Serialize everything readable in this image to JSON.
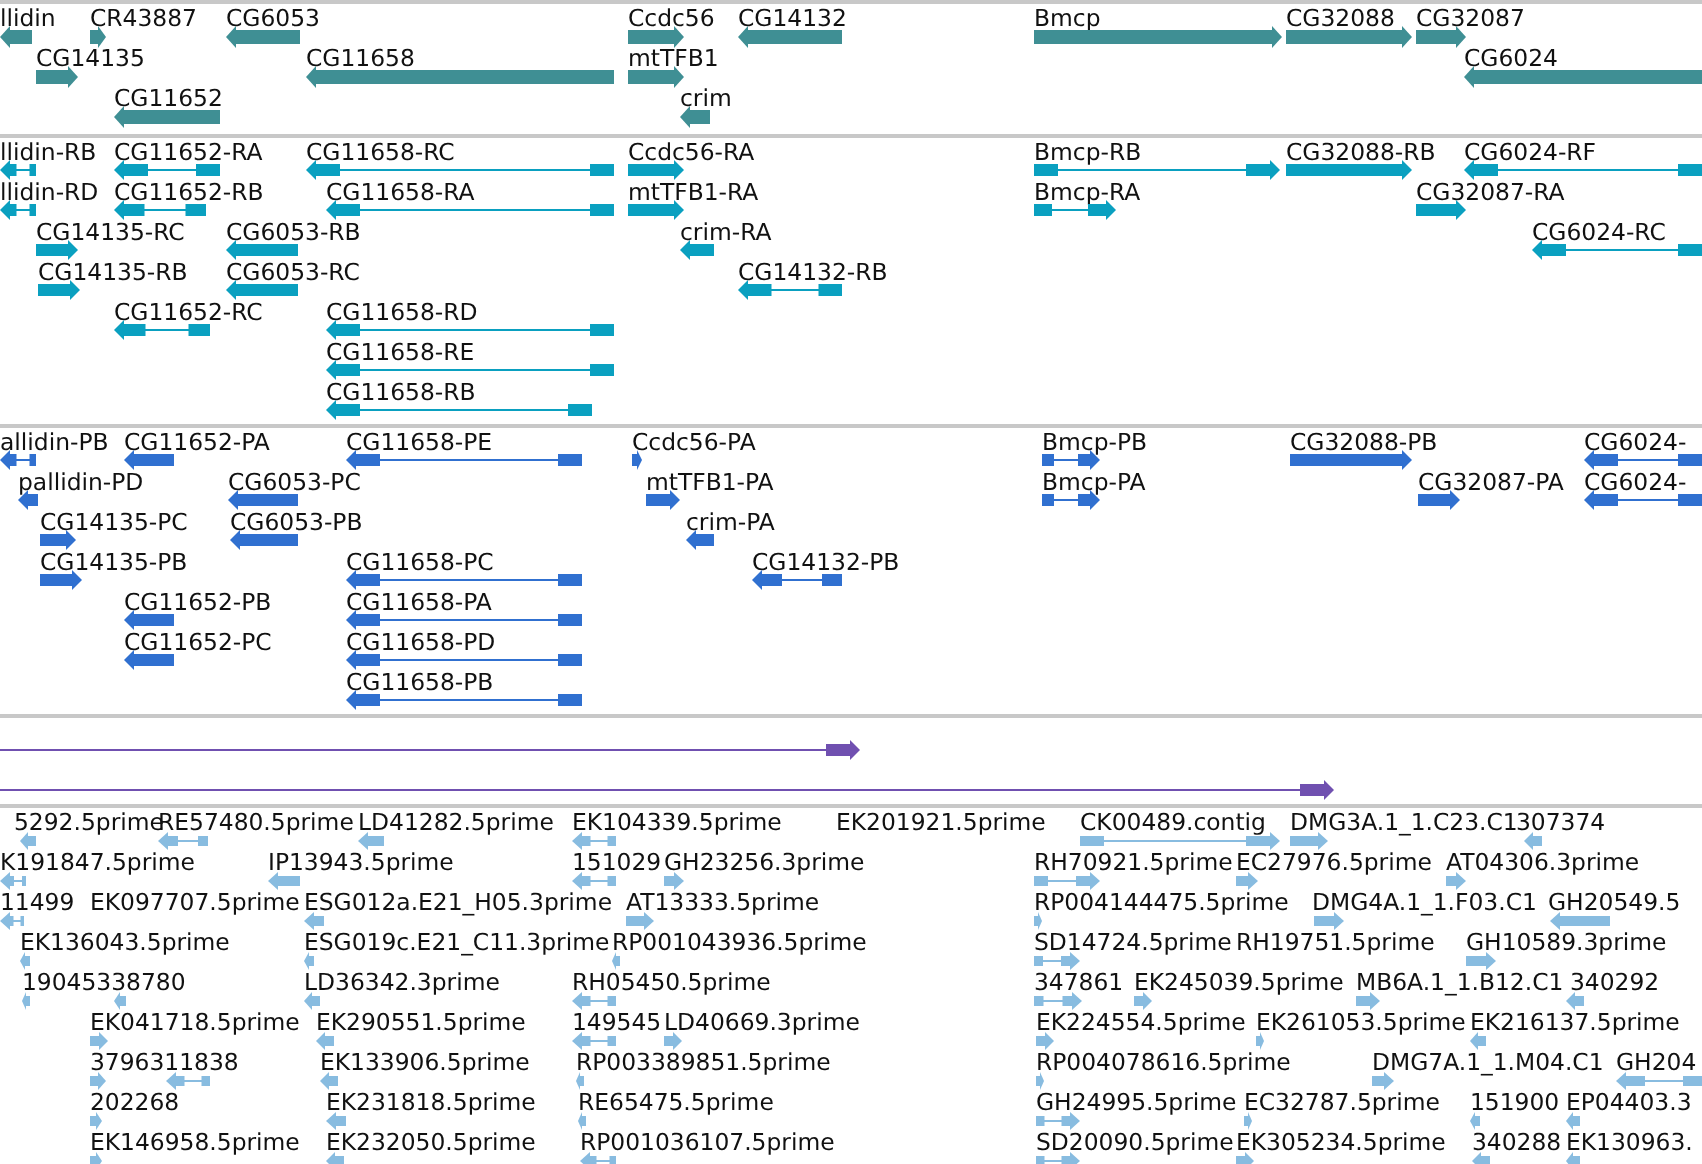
{
  "tracks": [
    {
      "color": "#3f8f94",
      "features": [
        {
          "label": "llidin",
          "reverse": true
        },
        {
          "label": "CR43887",
          "reverse": false
        },
        {
          "label": "CG6053",
          "reverse": true
        },
        {
          "label": "Ccdc56",
          "reverse": false
        },
        {
          "label": "CG14132",
          "reverse": true
        },
        {
          "label": "Bmcp",
          "reverse": false
        },
        {
          "label": "CG32088",
          "reverse": false
        },
        {
          "label": "CG32087",
          "reverse": false
        },
        {
          "label": "CG14135",
          "reverse": false
        },
        {
          "label": "CG11658",
          "reverse": true
        },
        {
          "label": "mtTFB1",
          "reverse": false
        },
        {
          "label": "CG6024",
          "reverse": true
        },
        {
          "label": "CG11652",
          "reverse": true
        },
        {
          "label": "crim",
          "reverse": true
        }
      ]
    },
    {
      "color": "#0aa0c0",
      "features": [
        {
          "label": "llidin-RB",
          "reverse": true
        },
        {
          "label": "CG11652-RA",
          "reverse": true
        },
        {
          "label": "CG11658-RC",
          "reverse": true
        },
        {
          "label": "Ccdc56-RA",
          "reverse": false
        },
        {
          "label": "Bmcp-RB",
          "reverse": false
        },
        {
          "label": "CG32088-RB",
          "reverse": false
        },
        {
          "label": "CG6024-RF",
          "reverse": true
        },
        {
          "label": "llidin-RD",
          "reverse": true
        },
        {
          "label": "CG11652-RB",
          "reverse": true
        },
        {
          "label": "CG11658-RA",
          "reverse": true
        },
        {
          "label": "mtTFB1-RA",
          "reverse": false
        },
        {
          "label": "Bmcp-RA",
          "reverse": false
        },
        {
          "label": "CG32087-RA",
          "reverse": false
        },
        {
          "label": "CG14135-RC",
          "reverse": false
        },
        {
          "label": "CG6053-RB",
          "reverse": true
        },
        {
          "label": "crim-RA",
          "reverse": true
        },
        {
          "label": "CG6024-RC",
          "reverse": true
        },
        {
          "label": "CG14135-RB",
          "reverse": false
        },
        {
          "label": "CG6053-RC",
          "reverse": true
        },
        {
          "label": "CG14132-RB",
          "reverse": true
        },
        {
          "label": "CG11652-RC",
          "reverse": true
        },
        {
          "label": "CG11658-RD",
          "reverse": true
        },
        {
          "label": "CG11658-RE",
          "reverse": true
        },
        {
          "label": "CG11658-RB",
          "reverse": true
        }
      ]
    },
    {
      "color": "#3070d0",
      "features": [
        {
          "label": "allidin-PB",
          "reverse": true
        },
        {
          "label": "CG11652-PA",
          "reverse": true
        },
        {
          "label": "CG11658-PE",
          "reverse": true
        },
        {
          "label": "Ccdc56-PA",
          "reverse": false
        },
        {
          "label": "Bmcp-PB",
          "reverse": false
        },
        {
          "label": "CG32088-PB",
          "reverse": false
        },
        {
          "label": "CG6024-",
          "reverse": true
        },
        {
          "label": "pallidin-PD",
          "reverse": true
        },
        {
          "label": "CG6053-PC",
          "reverse": true
        },
        {
          "label": "mtTFB1-PA",
          "reverse": false
        },
        {
          "label": "Bmcp-PA",
          "reverse": false
        },
        {
          "label": "CG32087-PA",
          "reverse": false
        },
        {
          "label": "CG6024-",
          "reverse": true
        },
        {
          "label": "CG14135-PC",
          "reverse": false
        },
        {
          "label": "CG6053-PB",
          "reverse": true
        },
        {
          "label": "crim-PA",
          "reverse": true
        },
        {
          "label": "CG14135-PB",
          "reverse": false
        },
        {
          "label": "CG11658-PC",
          "reverse": true
        },
        {
          "label": "CG14132-PB",
          "reverse": true
        },
        {
          "label": "CG11652-PB",
          "reverse": true
        },
        {
          "label": "CG11658-PA",
          "reverse": true
        },
        {
          "label": "CG11652-PC",
          "reverse": true
        },
        {
          "label": "CG11658-PD",
          "reverse": true
        },
        {
          "label": "CG11658-PB",
          "reverse": true
        }
      ]
    },
    {
      "color": "#7050b0",
      "features": [
        {
          "reverse": false
        },
        {
          "reverse": false
        }
      ]
    },
    {
      "color": "#88bce0",
      "features": [
        {
          "label": "5292.5prime",
          "reverse": true
        },
        {
          "label": "RE57480.5prime",
          "reverse": true
        },
        {
          "label": "LD41282.5prime",
          "reverse": true
        },
        {
          "label": "EK104339.5prime",
          "reverse": true
        },
        {
          "label": "EK201921.5prime"
        },
        {
          "label": "CK00489.contig",
          "reverse": false
        },
        {
          "label": "DMG3A.1_1.C23.C1",
          "reverse": false
        },
        {
          "label": "307374",
          "reverse": true
        },
        {
          "label": "K191847.5prime",
          "reverse": true
        },
        {
          "label": "IP13943.5prime",
          "reverse": true
        },
        {
          "label": "151029",
          "reverse": true
        },
        {
          "label": "GH23256.3prime",
          "reverse": false
        },
        {
          "label": "RH70921.5prime",
          "reverse": false
        },
        {
          "label": "EC27976.5prime",
          "reverse": false
        },
        {
          "label": "AT04306.3prime",
          "reverse": false
        },
        {
          "label": "11499",
          "reverse": true
        },
        {
          "label": "EK097707.5prime"
        },
        {
          "label": "ESG012a.E21_H05.3prime",
          "reverse": true
        },
        {
          "label": "AT13333.5prime",
          "reverse": false
        },
        {
          "label": "RP004144475.5prime",
          "reverse": false
        },
        {
          "label": "DMG4A.1_1.F03.C1",
          "reverse": false
        },
        {
          "label": "GH20549.5",
          "reverse": true
        },
        {
          "label": "EK136043.5prime",
          "reverse": true
        },
        {
          "label": "ESG019c.E21_C11.3prime",
          "reverse": true
        },
        {
          "label": "RP001043936.5prime",
          "reverse": true
        },
        {
          "label": "SD14724.5prime",
          "reverse": false
        },
        {
          "label": "RH19751.5prime"
        },
        {
          "label": "GH10589.3prime",
          "reverse": false
        },
        {
          "label": "19045338780",
          "reverse": true
        },
        {
          "reverse": true
        },
        {
          "label": "LD36342.3prime",
          "reverse": true
        },
        {
          "label": "RH05450.5prime",
          "reverse": true
        },
        {
          "label": "347861",
          "reverse": false
        },
        {
          "label": "EK245039.5prime",
          "reverse": false
        },
        {
          "label": "MB6A.1_1.B12.C1",
          "reverse": false
        },
        {
          "label": "340292",
          "reverse": true
        },
        {
          "label": "EK041718.5prime",
          "reverse": false
        },
        {
          "label": "EK290551.5prime",
          "reverse": true
        },
        {
          "label": "149545",
          "reverse": true
        },
        {
          "label": "LD40669.3prime",
          "reverse": false
        },
        {
          "label": "EK224554.5prime",
          "reverse": false
        },
        {
          "label": "EK261053.5prime",
          "reverse": false
        },
        {
          "label": "EK216137.5prime",
          "reverse": true
        },
        {
          "label": "3796311838",
          "reverse": false
        },
        {
          "reverse": true
        },
        {
          "label": "EK133906.5prime",
          "reverse": true
        },
        {
          "label": "RP003389851.5prime",
          "reverse": true
        },
        {
          "label": "RP004078616.5prime",
          "reverse": false
        },
        {
          "label": "DMG7A.1_1.M04.C1",
          "reverse": false
        },
        {
          "label": "GH204",
          "reverse": true
        },
        {
          "label": "202268",
          "reverse": false
        },
        {
          "label": "EK231818.5prime",
          "reverse": true
        },
        {
          "label": "RE65475.5prime",
          "reverse": true
        },
        {
          "label": "GH24995.5prime",
          "reverse": false
        },
        {
          "label": "EC32787.5prime",
          "reverse": false
        },
        {
          "label": "151900",
          "reverse": true
        },
        {
          "label": "EP04403.3",
          "reverse": true
        },
        {
          "label": "EK146958.5prime",
          "reverse": false
        },
        {
          "label": "EK232050.5prime",
          "reverse": true
        },
        {
          "label": "RP001036107.5prime",
          "reverse": true
        },
        {
          "label": "SD20090.5prime",
          "reverse": false
        },
        {
          "label": "EK305234.5prime",
          "reverse": false
        },
        {
          "label": "340288",
          "reverse": true
        },
        {
          "label": "EK130963.",
          "reverse": true
        }
      ]
    }
  ]
}
